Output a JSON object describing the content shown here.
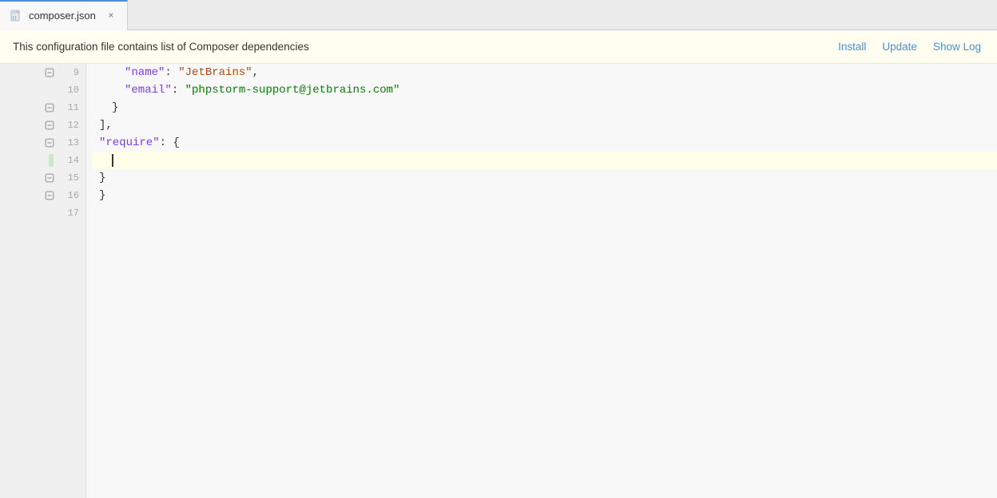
{
  "tab": {
    "label": "composer.json",
    "close_label": "×",
    "icon": "json-file-icon"
  },
  "info_bar": {
    "text": "This configuration file contains list of Composer dependencies",
    "install_label": "Install",
    "update_label": "Update",
    "show_log_label": "Show Log"
  },
  "editor": {
    "lines": [
      {
        "number": "9",
        "fold": true,
        "content": "name_line",
        "current": false
      },
      {
        "number": "10",
        "fold": false,
        "content": "email_line",
        "current": false
      },
      {
        "number": "11",
        "fold": true,
        "content": "close1",
        "current": false
      },
      {
        "number": "12",
        "fold": true,
        "content": "comma_bracket",
        "current": false
      },
      {
        "number": "13",
        "fold": true,
        "content": "require_line",
        "current": false
      },
      {
        "number": "14",
        "fold": false,
        "content": "cursor_line",
        "current": true
      },
      {
        "number": "15",
        "fold": true,
        "content": "close2",
        "current": false
      },
      {
        "number": "16",
        "fold": true,
        "content": "close3",
        "current": false
      },
      {
        "number": "17",
        "fold": false,
        "content": "empty",
        "current": false
      }
    ],
    "name_text": "\"name\": \"JetBrains\",",
    "email_key": "\"email\"",
    "email_val": "\"phpstorm-support@jetbrains.com\"",
    "require_key": "\"require\"",
    "colors": {
      "key": "#7c3aed",
      "string_name": "#b5490a",
      "string_value": "#0a7a0a",
      "bracket": "#333",
      "punct": "#333"
    }
  }
}
